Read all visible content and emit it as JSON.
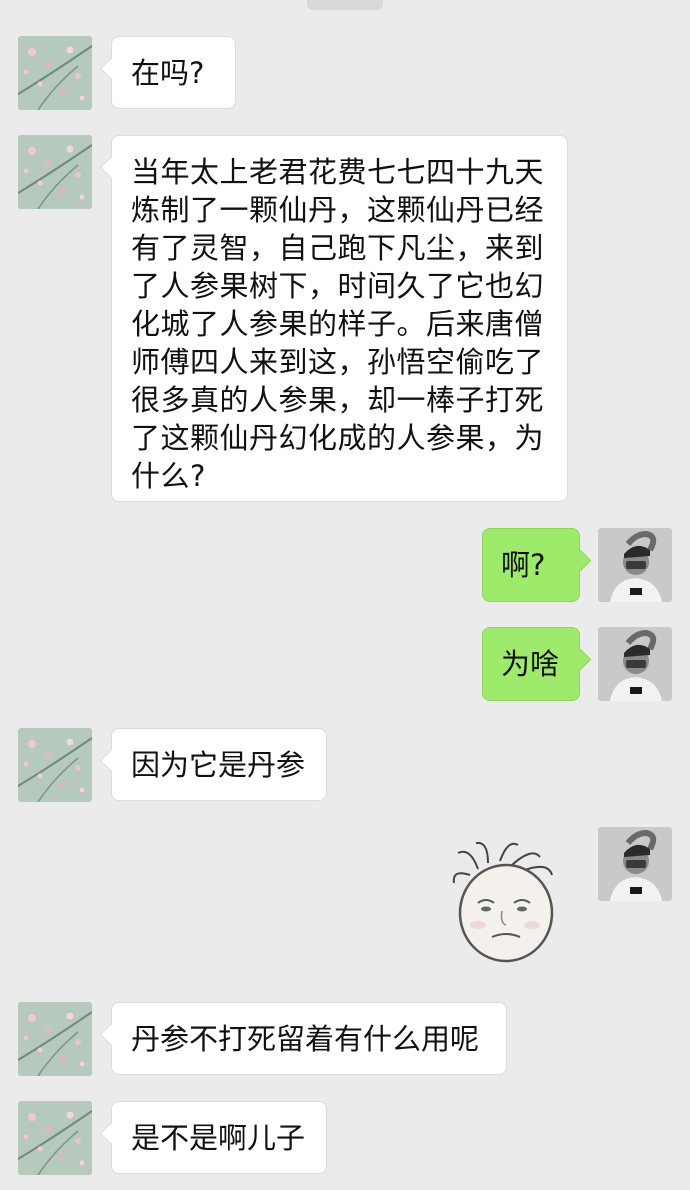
{
  "chat": {
    "messages": [
      {
        "side": "left",
        "text": "在吗?"
      },
      {
        "side": "left",
        "text": "当年太上老君花费七七四十九天炼制了一颗仙丹，这颗仙丹已经有了灵智，自己跑下凡尘，来到了人参果树下，时间久了它也幻化城了人参果的样子。后来唐僧师傅四人来到这，孙悟空偷吃了很多真的人参果，却一棒子打死了这颗仙丹幻化成的人参果，为什么?"
      },
      {
        "side": "right",
        "text": "啊?"
      },
      {
        "side": "right",
        "text": "为啥"
      },
      {
        "side": "left",
        "text": "因为它是丹参"
      },
      {
        "side": "right",
        "sticker": "baozou-face-sticker"
      },
      {
        "side": "left",
        "text": "丹参不打死留着有什么用呢"
      },
      {
        "side": "left",
        "text": "是不是啊儿子"
      }
    ],
    "long_lines": [
      "当年太上老君花费七七四十九天",
      "炼制了一颗仙丹，这颗仙丹已经",
      "有了灵智，自己跑下凡尘，来到",
      "了人参果树下，时间久了它也幻",
      "化城了人参果的样子。后来唐僧",
      "师傅四人来到这，孙悟空偷吃了",
      "很多真的人参果，却一棒子打死",
      "了这颗仙丹幻化成的人参果，为",
      "什么?"
    ]
  },
  "colors": {
    "background": "#ebebeb",
    "bubble_left": "#ffffff",
    "bubble_right": "#9eea6a"
  },
  "icons": {
    "left_avatar": "blossom-avatar-icon",
    "right_avatar": "person-avatar-icon"
  }
}
